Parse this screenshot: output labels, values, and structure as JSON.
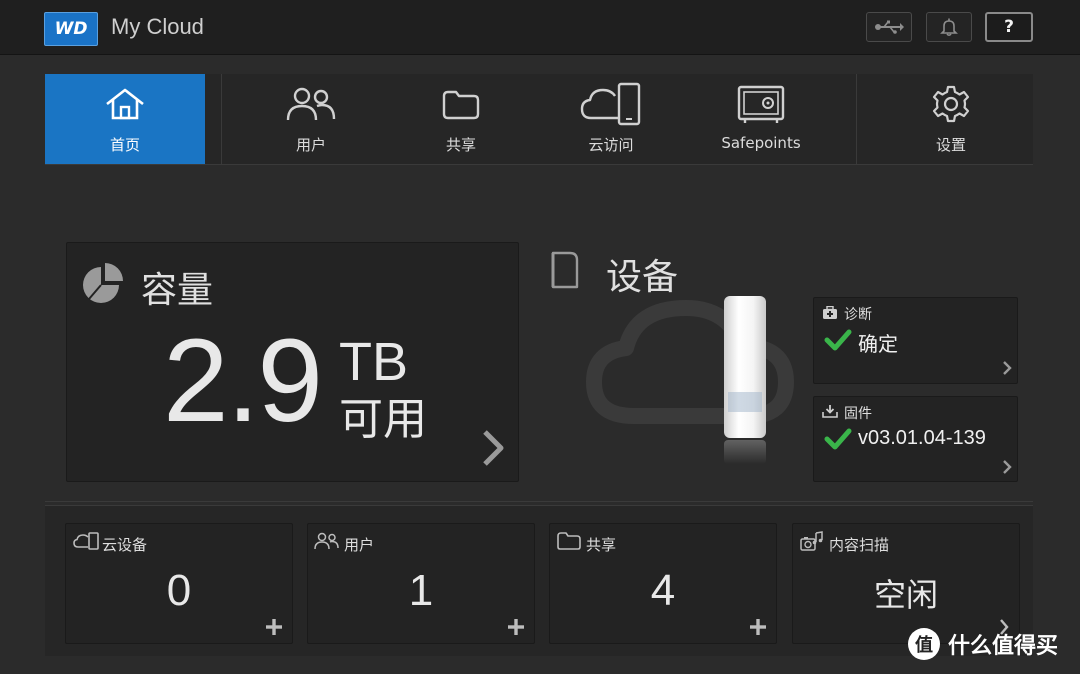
{
  "header": {
    "logo_text": "WD",
    "title": "My Cloud",
    "usb_icon": "usb-icon",
    "bell_icon": "bell-icon",
    "help_label": "?"
  },
  "nav": {
    "items": [
      {
        "label": "首页",
        "icon": "home-icon",
        "active": true
      },
      {
        "label": "用户",
        "icon": "users-icon"
      },
      {
        "label": "共享",
        "icon": "folder-icon"
      },
      {
        "label": "云访问",
        "icon": "cloud-phone-icon"
      },
      {
        "label": "Safepoints",
        "icon": "safe-icon"
      },
      {
        "label": "设置",
        "icon": "gear-icon"
      }
    ]
  },
  "capacity": {
    "title": "容量",
    "value": "2.9",
    "unit": "TB",
    "available": "可用"
  },
  "device": {
    "title": "设备",
    "diagnostics": {
      "label": "诊断",
      "value": "确定"
    },
    "firmware": {
      "label": "固件",
      "value": "v03.01.04-139"
    }
  },
  "stats": [
    {
      "label": "云设备",
      "value": "0",
      "icon": "cloud-device-icon"
    },
    {
      "label": "用户",
      "value": "1",
      "icon": "users-icon"
    },
    {
      "label": "共享",
      "value": "4",
      "icon": "folder-icon"
    },
    {
      "label": "内容扫描",
      "value": "空闲",
      "icon": "media-scan-icon"
    }
  ],
  "watermark": {
    "text": "什么值得买",
    "badge": "值"
  },
  "colors": {
    "accent": "#1a75c4",
    "check": "#3ab54a",
    "background": "#2b2b2b"
  }
}
